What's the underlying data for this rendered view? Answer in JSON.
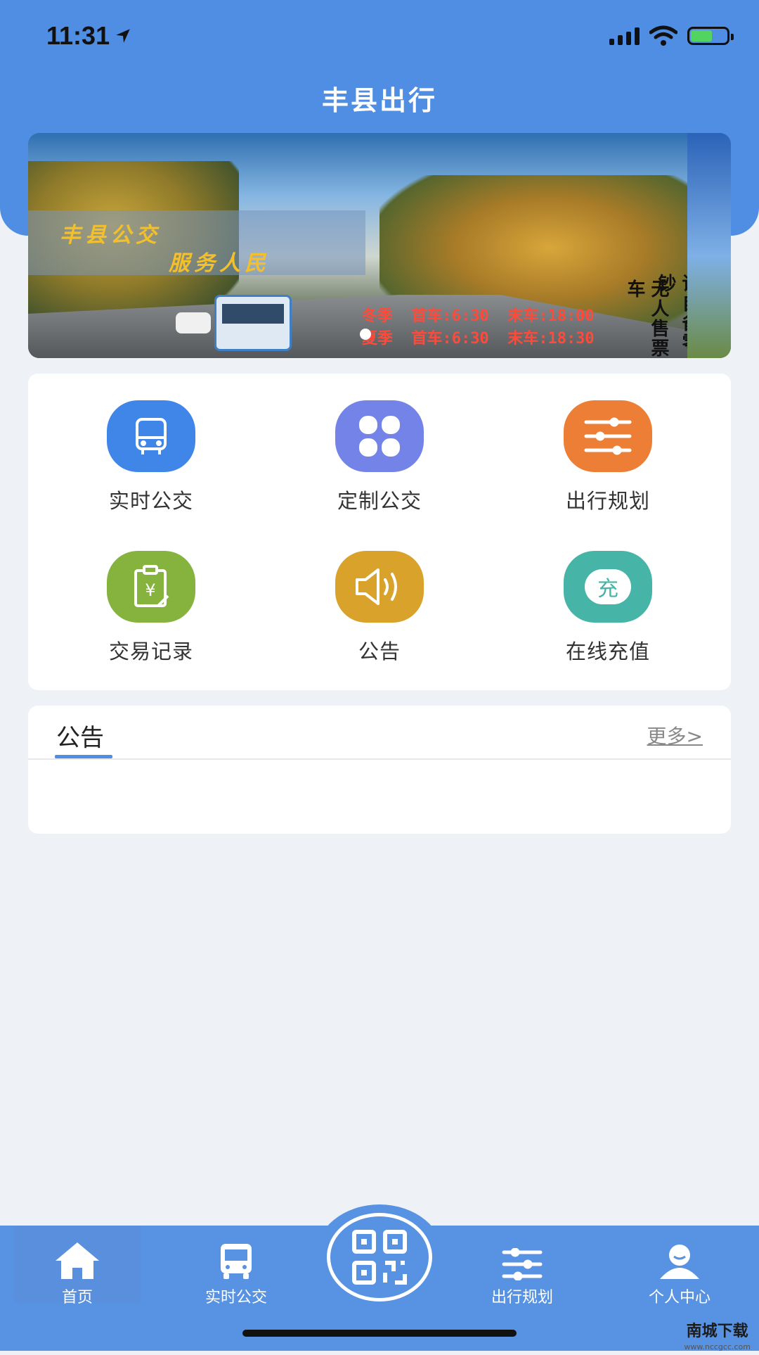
{
  "status_bar": {
    "time": "11:31"
  },
  "header": {
    "title": "丰县出行"
  },
  "banner": {
    "slogan_line1": "丰县公交",
    "slogan_line2": "服务人民",
    "schedule_winter": "冬季  首车:6:30  末车:18:00",
    "schedule_summer": "夏季  首车:6:30  末车:18:30",
    "notice_col1": "无人售票车",
    "notice_col2": "请自备零钞"
  },
  "grid": {
    "items": [
      {
        "label": "实时公交",
        "icon": "bus-icon",
        "color": "#3f86e8"
      },
      {
        "label": "定制公交",
        "icon": "clover-icon",
        "color": "#7483e8"
      },
      {
        "label": "出行规划",
        "icon": "sliders-icon",
        "color": "#ec7e35"
      },
      {
        "label": "交易记录",
        "icon": "receipt-icon",
        "color": "#86b23e"
      },
      {
        "label": "公告",
        "icon": "speaker-icon",
        "color": "#d9a22b"
      },
      {
        "label": "在线充值",
        "icon": "recharge-icon",
        "color": "#46b4a6",
        "badge": "充"
      }
    ]
  },
  "notice": {
    "title": "公告",
    "more": "更多>"
  },
  "tabbar": {
    "items": [
      {
        "label": "首页",
        "icon": "home-icon"
      },
      {
        "label": "实时公交",
        "icon": "bus-icon"
      },
      {
        "label": "",
        "icon": "qr-code-icon"
      },
      {
        "label": "出行规划",
        "icon": "sliders-icon"
      },
      {
        "label": "个人中心",
        "icon": "user-icon"
      }
    ]
  },
  "watermark": {
    "text": "南城下载",
    "url": "www.nccgcc.com"
  }
}
